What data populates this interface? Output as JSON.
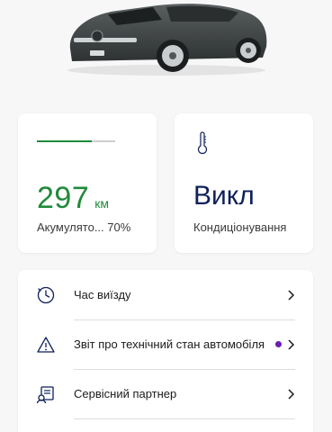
{
  "range": {
    "value": "297",
    "unit": "км",
    "label": "Акумулято... 70%",
    "battery_fraction": 0.7,
    "accent": "#1f8a3a"
  },
  "climate": {
    "icon": "thermometer-icon",
    "status": "Викл",
    "label": "Кондиціонування",
    "accent": "#0f1f5a"
  },
  "menu": {
    "items": [
      {
        "label": "Час виїзду",
        "icon": "clock-icon"
      },
      {
        "label": "Звіт про технічний стан автомобіля",
        "icon": "warning-icon",
        "badge_color": "#6a1fb0"
      },
      {
        "label": "Сервісний партнер",
        "icon": "service-partner-icon"
      }
    ]
  }
}
